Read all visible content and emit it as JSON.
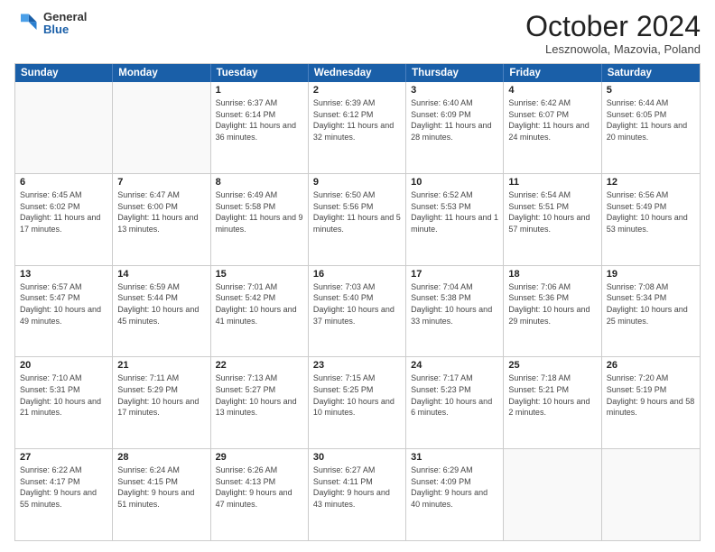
{
  "header": {
    "logo": {
      "general": "General",
      "blue": "Blue"
    },
    "title": "October 2024",
    "location": "Lesznowola, Mazovia, Poland"
  },
  "days_of_week": [
    "Sunday",
    "Monday",
    "Tuesday",
    "Wednesday",
    "Thursday",
    "Friday",
    "Saturday"
  ],
  "weeks": [
    [
      {
        "day": "",
        "empty": true
      },
      {
        "day": "",
        "empty": true
      },
      {
        "day": "1",
        "sunrise": "6:37 AM",
        "sunset": "6:14 PM",
        "daylight": "11 hours and 36 minutes."
      },
      {
        "day": "2",
        "sunrise": "6:39 AM",
        "sunset": "6:12 PM",
        "daylight": "11 hours and 32 minutes."
      },
      {
        "day": "3",
        "sunrise": "6:40 AM",
        "sunset": "6:09 PM",
        "daylight": "11 hours and 28 minutes."
      },
      {
        "day": "4",
        "sunrise": "6:42 AM",
        "sunset": "6:07 PM",
        "daylight": "11 hours and 24 minutes."
      },
      {
        "day": "5",
        "sunrise": "6:44 AM",
        "sunset": "6:05 PM",
        "daylight": "11 hours and 20 minutes."
      }
    ],
    [
      {
        "day": "6",
        "sunrise": "6:45 AM",
        "sunset": "6:02 PM",
        "daylight": "11 hours and 17 minutes."
      },
      {
        "day": "7",
        "sunrise": "6:47 AM",
        "sunset": "6:00 PM",
        "daylight": "11 hours and 13 minutes."
      },
      {
        "day": "8",
        "sunrise": "6:49 AM",
        "sunset": "5:58 PM",
        "daylight": "11 hours and 9 minutes."
      },
      {
        "day": "9",
        "sunrise": "6:50 AM",
        "sunset": "5:56 PM",
        "daylight": "11 hours and 5 minutes."
      },
      {
        "day": "10",
        "sunrise": "6:52 AM",
        "sunset": "5:53 PM",
        "daylight": "11 hours and 1 minute."
      },
      {
        "day": "11",
        "sunrise": "6:54 AM",
        "sunset": "5:51 PM",
        "daylight": "10 hours and 57 minutes."
      },
      {
        "day": "12",
        "sunrise": "6:56 AM",
        "sunset": "5:49 PM",
        "daylight": "10 hours and 53 minutes."
      }
    ],
    [
      {
        "day": "13",
        "sunrise": "6:57 AM",
        "sunset": "5:47 PM",
        "daylight": "10 hours and 49 minutes."
      },
      {
        "day": "14",
        "sunrise": "6:59 AM",
        "sunset": "5:44 PM",
        "daylight": "10 hours and 45 minutes."
      },
      {
        "day": "15",
        "sunrise": "7:01 AM",
        "sunset": "5:42 PM",
        "daylight": "10 hours and 41 minutes."
      },
      {
        "day": "16",
        "sunrise": "7:03 AM",
        "sunset": "5:40 PM",
        "daylight": "10 hours and 37 minutes."
      },
      {
        "day": "17",
        "sunrise": "7:04 AM",
        "sunset": "5:38 PM",
        "daylight": "10 hours and 33 minutes."
      },
      {
        "day": "18",
        "sunrise": "7:06 AM",
        "sunset": "5:36 PM",
        "daylight": "10 hours and 29 minutes."
      },
      {
        "day": "19",
        "sunrise": "7:08 AM",
        "sunset": "5:34 PM",
        "daylight": "10 hours and 25 minutes."
      }
    ],
    [
      {
        "day": "20",
        "sunrise": "7:10 AM",
        "sunset": "5:31 PM",
        "daylight": "10 hours and 21 minutes."
      },
      {
        "day": "21",
        "sunrise": "7:11 AM",
        "sunset": "5:29 PM",
        "daylight": "10 hours and 17 minutes."
      },
      {
        "day": "22",
        "sunrise": "7:13 AM",
        "sunset": "5:27 PM",
        "daylight": "10 hours and 13 minutes."
      },
      {
        "day": "23",
        "sunrise": "7:15 AM",
        "sunset": "5:25 PM",
        "daylight": "10 hours and 10 minutes."
      },
      {
        "day": "24",
        "sunrise": "7:17 AM",
        "sunset": "5:23 PM",
        "daylight": "10 hours and 6 minutes."
      },
      {
        "day": "25",
        "sunrise": "7:18 AM",
        "sunset": "5:21 PM",
        "daylight": "10 hours and 2 minutes."
      },
      {
        "day": "26",
        "sunrise": "7:20 AM",
        "sunset": "5:19 PM",
        "daylight": "9 hours and 58 minutes."
      }
    ],
    [
      {
        "day": "27",
        "sunrise": "6:22 AM",
        "sunset": "4:17 PM",
        "daylight": "9 hours and 55 minutes."
      },
      {
        "day": "28",
        "sunrise": "6:24 AM",
        "sunset": "4:15 PM",
        "daylight": "9 hours and 51 minutes."
      },
      {
        "day": "29",
        "sunrise": "6:26 AM",
        "sunset": "4:13 PM",
        "daylight": "9 hours and 47 minutes."
      },
      {
        "day": "30",
        "sunrise": "6:27 AM",
        "sunset": "4:11 PM",
        "daylight": "9 hours and 43 minutes."
      },
      {
        "day": "31",
        "sunrise": "6:29 AM",
        "sunset": "4:09 PM",
        "daylight": "9 hours and 40 minutes."
      },
      {
        "day": "",
        "empty": true
      },
      {
        "day": "",
        "empty": true
      }
    ]
  ],
  "labels": {
    "sunrise": "Sunrise:",
    "sunset": "Sunset:",
    "daylight": "Daylight:"
  }
}
